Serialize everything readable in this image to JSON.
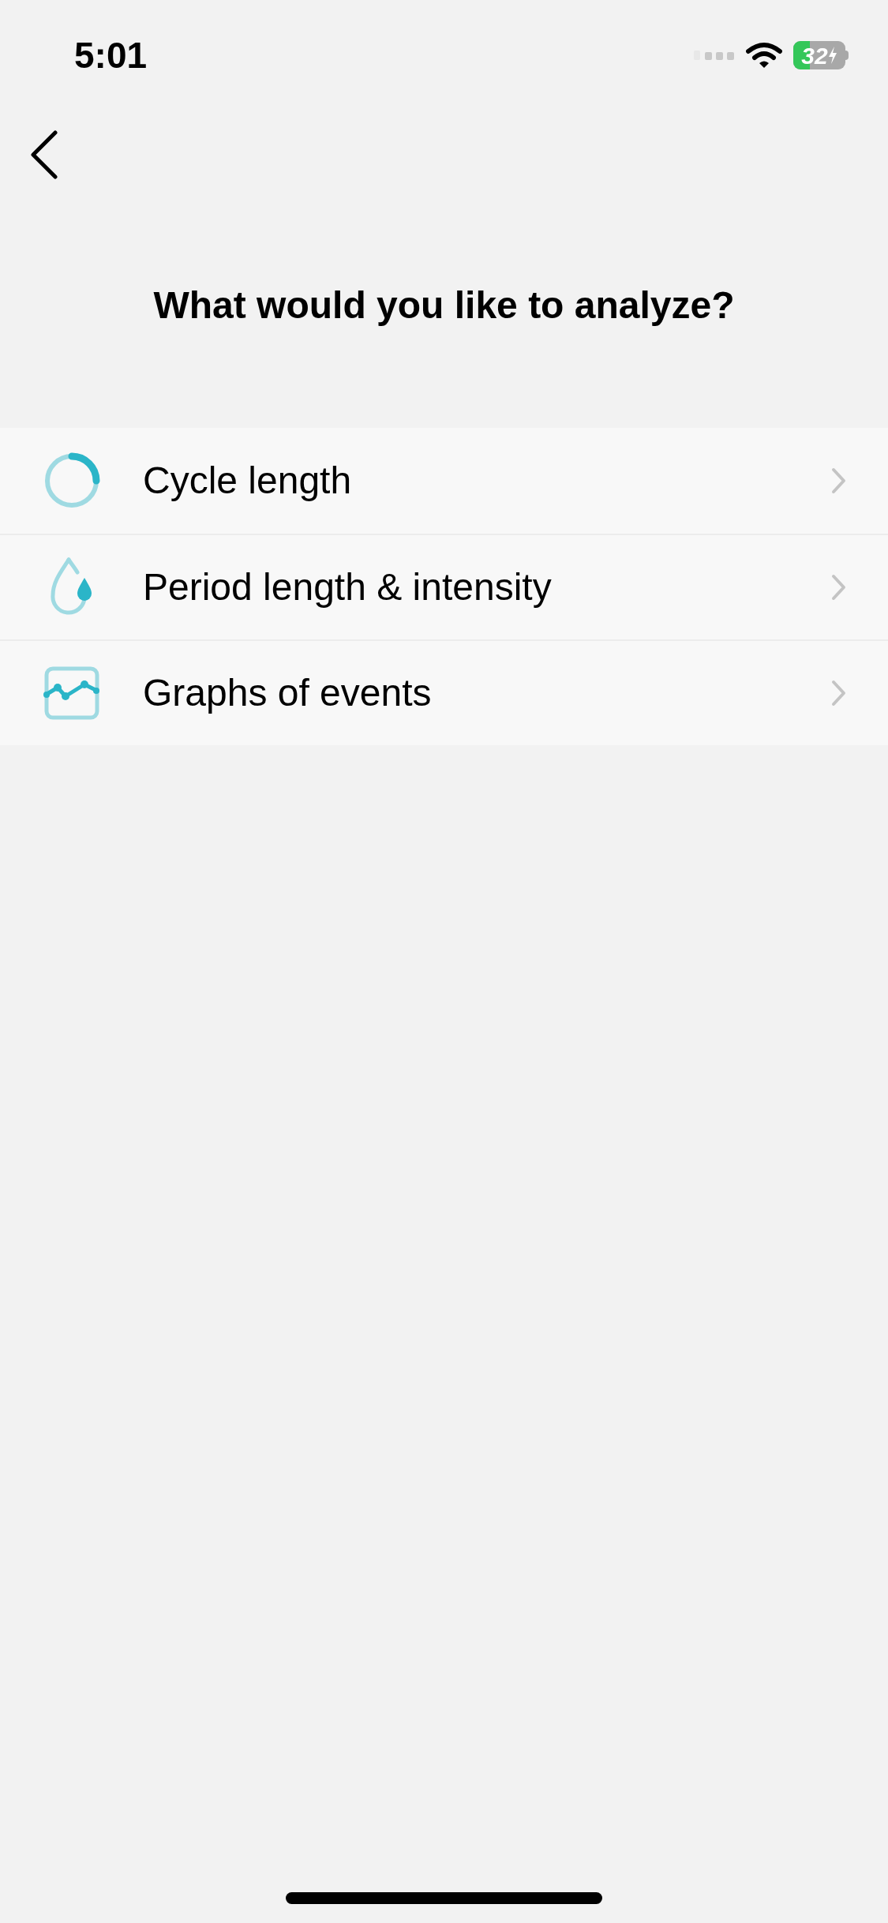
{
  "status_bar": {
    "time": "5:01",
    "battery": "32"
  },
  "title": "What would you like to analyze?",
  "items": [
    {
      "kind": "cycle",
      "label": "Cycle length"
    },
    {
      "kind": "drop",
      "label": "Period length & intensity"
    },
    {
      "kind": "graph",
      "label": "Graphs of events"
    }
  ]
}
